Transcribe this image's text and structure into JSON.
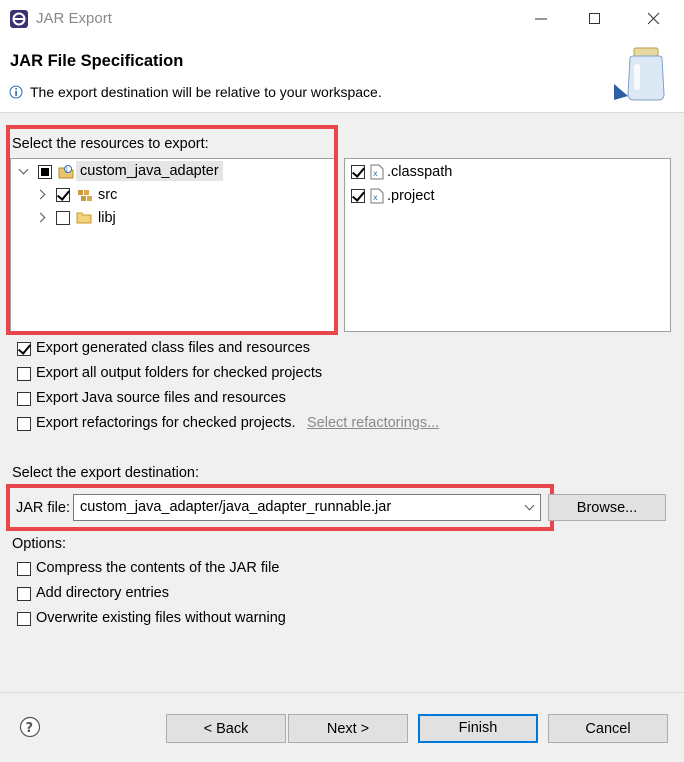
{
  "window": {
    "title": "JAR Export"
  },
  "header": {
    "title": "JAR File Specification",
    "message": "The export destination will be relative to your workspace."
  },
  "resources": {
    "label": "Select the resources to export:",
    "tree": [
      {
        "label": "custom_java_adapter",
        "state": "partial",
        "expanded": true
      },
      {
        "label": "src",
        "state": "checked",
        "expanded": false
      },
      {
        "label": "libj",
        "state": "unchecked",
        "expanded": false
      }
    ],
    "files": [
      {
        "label": ".classpath",
        "checked": true
      },
      {
        "label": ".project",
        "checked": true
      }
    ]
  },
  "options_top": [
    {
      "label": "Export generated class files and resources",
      "checked": true
    },
    {
      "label": "Export all output folders for checked projects",
      "checked": false
    },
    {
      "label": "Export Java source files and resources",
      "checked": false
    },
    {
      "label": "Export refactorings for checked projects.",
      "checked": false,
      "link": "Select refactorings..."
    }
  ],
  "destination": {
    "label": "Select the export destination:",
    "jar_label": "JAR file:",
    "jar_value": "custom_java_adapter/java_adapter_runnable.jar",
    "browse": "Browse..."
  },
  "options": {
    "label": "Options:",
    "items": [
      {
        "label": "Compress the contents of the JAR file",
        "checked": false
      },
      {
        "label": "Add directory entries",
        "checked": false
      },
      {
        "label": "Overwrite existing files without warning",
        "checked": false
      }
    ]
  },
  "buttons": {
    "back": "< Back",
    "next": "Next >",
    "finish": "Finish",
    "cancel": "Cancel"
  },
  "colors": {
    "highlight": "#e8454d",
    "accent": "#0078d7",
    "link": "#7f7f7f"
  }
}
